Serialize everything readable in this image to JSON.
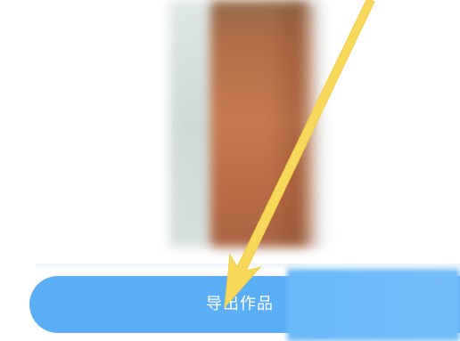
{
  "preview": {
    "icon": "blurred-photo-preview"
  },
  "export_button": {
    "label": "导出作品"
  },
  "annotation": {
    "icon": "yellow-arrow-pointer",
    "color": "#f7d85a"
  },
  "colors": {
    "button": "#5aaef5",
    "button_text": "#ffffff",
    "background": "#ffffff"
  }
}
